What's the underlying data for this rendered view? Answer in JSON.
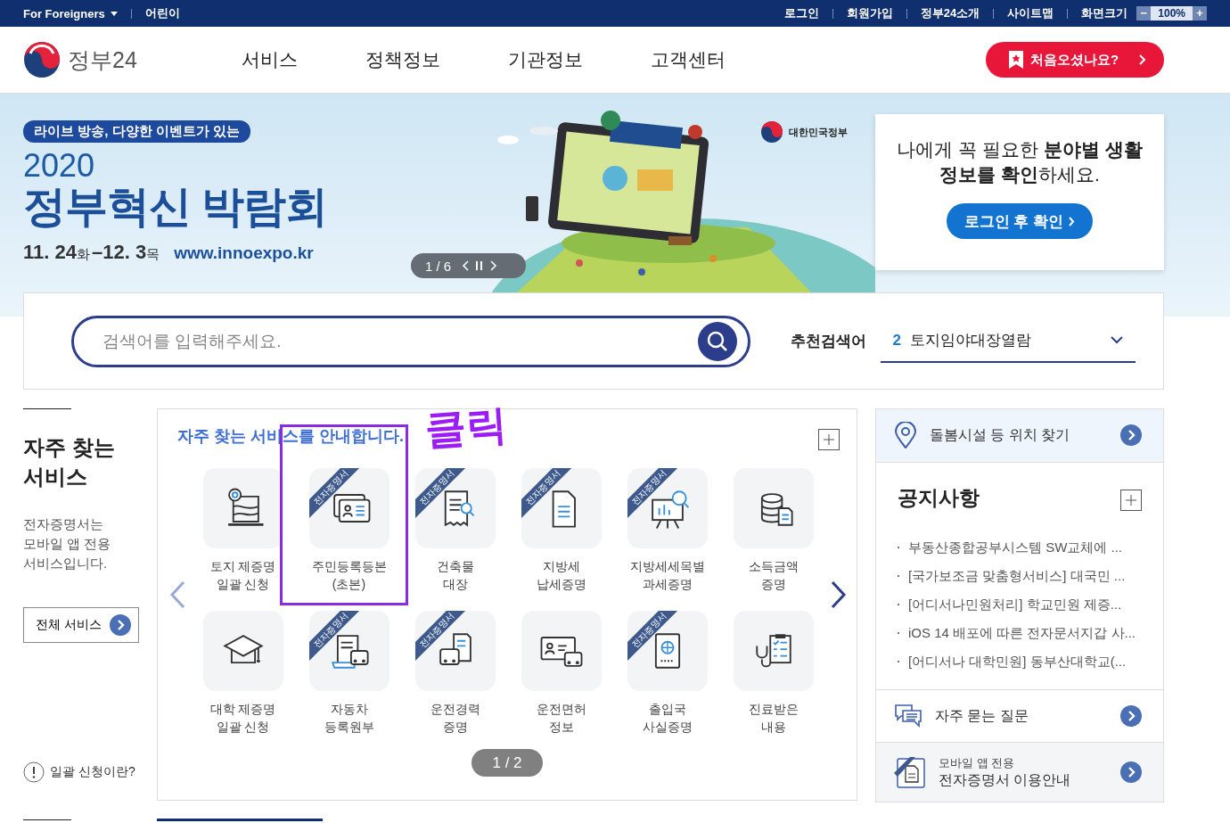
{
  "top_bar": {
    "left_links": [
      {
        "label": "For Foreigners",
        "kind": "dropdown"
      },
      {
        "label": "어린이",
        "kind": "link"
      }
    ],
    "right_links": [
      "로그인",
      "회원가입",
      "정부24소개",
      "사이트맵"
    ],
    "zoom": {
      "label": "화면크기",
      "decrease": "−",
      "value": "100%",
      "increase": "+"
    }
  },
  "header": {
    "logo_text": "정부24",
    "nav": [
      "서비스",
      "정책정보",
      "기관정보",
      "고객센터"
    ],
    "cta": "처음오셨나요?"
  },
  "banner": {
    "tag": "라이브 방송, 다양한 이벤트가 있는",
    "year": "2020",
    "title": "정부혁신 박람회",
    "dates": [
      {
        "date": "11. 24",
        "day": "화"
      },
      {
        "date": "–12. 3",
        "day": "목"
      }
    ],
    "url": "www.innoexpo.kr",
    "slide_counter": "1 / 6",
    "org": "대한민국정부"
  },
  "login_card": {
    "message": "나에게 꼭 필요한 **분야별 생활 정보를 확인**하세요.",
    "button": "로그인 후 확인"
  },
  "search": {
    "placeholder": "검색어를 입력해주세요.",
    "recommended_label": "추천검색어",
    "recommended": {
      "rank": "2",
      "term": "토지임야대장열람"
    }
  },
  "side": {
    "title": "자주 찾는 서비스",
    "description": "전자증명서는 모바일 앱 전용 서비스입니다.",
    "all_button": "전체 서비스",
    "help_link": "일괄 신청이란?"
  },
  "services": {
    "title": "자주 찾는 서비스**를 안내합니다.**",
    "annotation": "클릭",
    "pager": "1 / 2",
    "items": [
      {
        "label": "토지 제증명\n일괄 신청",
        "highlighted": false
      },
      {
        "label": "주민등록등본\n(초본)",
        "badge": "전자증명서",
        "highlighted": true
      },
      {
        "label": "건축물\n대장",
        "badge": "전자증명서",
        "highlighted": false
      },
      {
        "label": "지방세\n납세증명",
        "badge": "전자증명서",
        "highlighted": false
      },
      {
        "label": "지방세세목별\n과세증명",
        "badge": "전자증명서",
        "highlighted": false
      },
      {
        "label": "소득금액\n증명",
        "highlighted": false
      },
      {
        "label": "대학 제증명\n일괄 신청",
        "highlighted": false
      },
      {
        "label": "자동차\n등록원부",
        "badge": "전자증명서",
        "highlighted": false
      },
      {
        "label": "운전경력\n증명",
        "badge": "전자증명서",
        "highlighted": false
      },
      {
        "label": "운전면허\n정보",
        "highlighted": false
      },
      {
        "label": "출입국\n사실증명",
        "badge": "전자증명서",
        "highlighted": false
      },
      {
        "label": "진료받은\n내용",
        "highlighted": false
      }
    ]
  },
  "right_panel": {
    "location": "돌봄시설 등 위치 찾기",
    "notices": {
      "title": "공지사항",
      "items": [
        "부동산종합공부시스템 SW교체에 ...",
        "[국가보조금 맞춤형서비스] 대국민 ...",
        "[어디서나민원처리] 학교민원 제증...",
        "iOS 14 배포에 따른 전자문서지갑 사...",
        "[어디서나 대학민원] 동부산대학교(..."
      ]
    },
    "faq": "자주 묻는 질문",
    "mobile": {
      "line1": "모바일 앱 전용",
      "line2": "전자증명서 이용안내"
    }
  }
}
